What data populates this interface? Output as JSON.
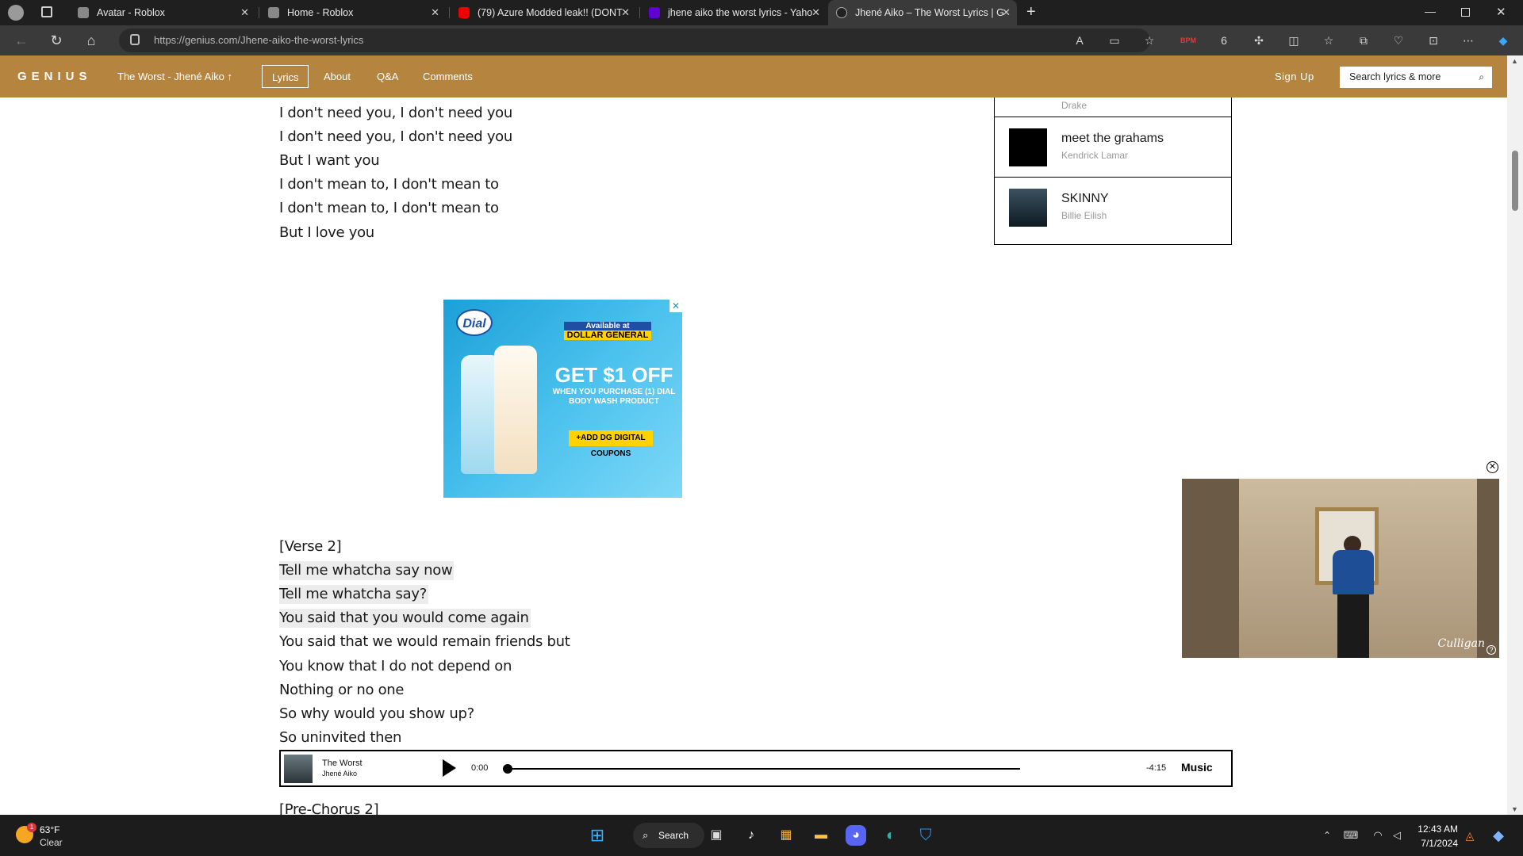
{
  "browser": {
    "tabs": [
      {
        "title": "Avatar - Roblox",
        "favicon": "roblox-icon"
      },
      {
        "title": "Home - Roblox",
        "favicon": "roblox-icon"
      },
      {
        "title": "(79) Azure Modded leak!! (DONT",
        "favicon": "youtube-icon"
      },
      {
        "title": "jhene aiko the worst lyrics - Yaho",
        "favicon": "yahoo-icon"
      },
      {
        "title": "Jhené Aiko – The Worst Lyrics | G",
        "favicon": "genius-icon"
      }
    ],
    "active_tab_index": 4,
    "url": "https://genius.com/Jhene-aiko-the-worst-lyrics"
  },
  "genius": {
    "logo": "GENIUS",
    "song_crumb": "The Worst - Jhené Aiko",
    "nav": [
      "Lyrics",
      "About",
      "Q&A",
      "Comments"
    ],
    "active_nav": "Lyrics",
    "sign_up": "Sign Up",
    "search_placeholder": "Search lyrics & more"
  },
  "lyrics_top": [
    "I don't need you, I don't need you",
    "I don't need you, I don't need you",
    "But I want you",
    "I don't mean to, I don't mean to",
    "I don't mean to, I don't mean to",
    "But I love you"
  ],
  "lyrics_verse": [
    {
      "text": "[Verse 2]",
      "highlight": false
    },
    {
      "text": "Tell me whatcha say now",
      "highlight": true
    },
    {
      "text": "Tell me whatcha say?",
      "highlight": true
    },
    {
      "text": "You said that you would come again",
      "highlight": true
    },
    {
      "text": "You said that we would remain friends but",
      "highlight": false
    },
    {
      "text": "You know that I do not depend on",
      "highlight": false
    },
    {
      "text": "Nothing or no one",
      "highlight": false
    },
    {
      "text": "So why would you show up?",
      "highlight": false
    },
    {
      "text": "So uninvited then",
      "highlight": false
    }
  ],
  "lyrics_next_section": "[Pre-Chorus 2]",
  "ad": {
    "brand": "Dial",
    "available_at": "Available at",
    "store": "DOLLAR GENERAL",
    "offer": "GET $1 OFF",
    "offer_detail": "WHEN YOU PURCHASE (1) DIAL BODY WASH PRODUCT",
    "coupon": "+ADD DG DIGITAL COUPONS"
  },
  "sidebar": {
    "partial_artist": "Drake",
    "items": [
      {
        "title": "meet the grahams",
        "artist": "Kendrick Lamar"
      },
      {
        "title": "SKINNY",
        "artist": "Billie Eilish"
      }
    ]
  },
  "player": {
    "title": "The Worst",
    "artist": "Jhené Aiko",
    "elapsed": "0:00",
    "remaining": "-4:15",
    "brand": "Music",
    "progress": 0
  },
  "video": {
    "brand": "Culligan"
  },
  "taskbar": {
    "temperature": "63°F",
    "condition": "Clear",
    "search_label": "Search",
    "time": "12:43 AM",
    "date": "7/1/2024",
    "weather_badge": "1"
  }
}
